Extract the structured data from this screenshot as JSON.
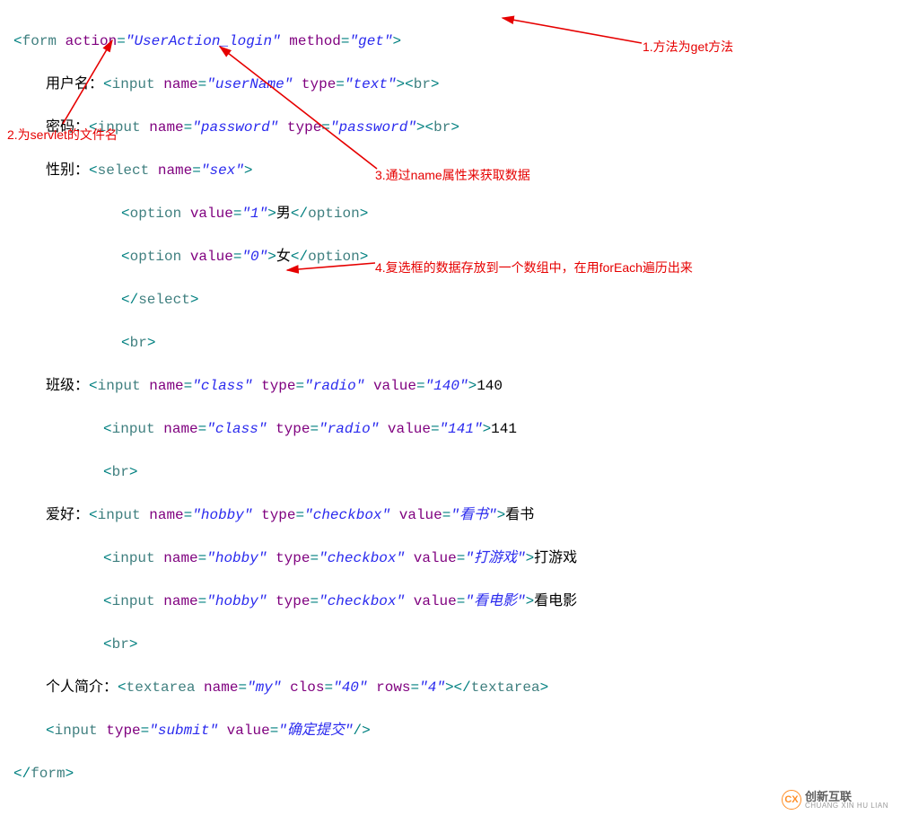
{
  "code": {
    "l1": {
      "b1": "<",
      "tag": "form",
      "a1": "action",
      "v1": "\"UserAction_login\"",
      "a2": "method",
      "v2": "\"get\"",
      "b2": ">"
    },
    "l2": {
      "label": "用户名：",
      "b1": "<",
      "tag": "input",
      "a1": "name",
      "v1": "\"userName\"",
      "a2": "type",
      "v2": "\"text\"",
      "b2": "><",
      "tag2": "br",
      "b3": ">"
    },
    "l3": {
      "label": "密码：",
      "b1": "<",
      "tag": "input",
      "a1": "name",
      "v1": "\"password\"",
      "a2": "type",
      "v2": "\"password\"",
      "b2": "><",
      "tag2": "br",
      "b3": ">"
    },
    "l4": {
      "label": "性别：",
      "b1": "<",
      "tag": "select",
      "a1": "name",
      "v1": "\"sex\"",
      "b2": ">"
    },
    "l5": {
      "b1": "<",
      "tag": "option",
      "a1": "value",
      "v1": "\"1\"",
      "b2": ">",
      "text": "男",
      "b3": "</",
      "tag2": "option",
      "b4": ">"
    },
    "l6": {
      "b1": "<",
      "tag": "option",
      "a1": "value",
      "v1": "\"0\"",
      "b2": ">",
      "text": "女",
      "b3": "</",
      "tag2": "option",
      "b4": ">"
    },
    "l7": {
      "b1": "</",
      "tag": "select",
      "b2": ">"
    },
    "l8": {
      "b1": "<",
      "tag": "br",
      "b2": ">"
    },
    "l9": {
      "label": "班级：",
      "b1": "<",
      "tag": "input",
      "a1": "name",
      "v1": "\"class\"",
      "a2": "type",
      "v2": "\"radio\"",
      "a3": "value",
      "v3": "\"140\"",
      "b2": ">",
      "text": "140"
    },
    "l10": {
      "b1": "<",
      "tag": "input",
      "a1": "name",
      "v1": "\"class\"",
      "a2": "type",
      "v2": "\"radio\"",
      "a3": "value",
      "v3": "\"141\"",
      "b2": ">",
      "text": "141"
    },
    "l11": {
      "b1": "<",
      "tag": "br",
      "b2": ">"
    },
    "l12": {
      "label": "爱好：",
      "b1": "<",
      "tag": "input",
      "a1": "name",
      "v1": "\"hobby\"",
      "a2": "type",
      "v2": "\"checkbox\"",
      "a3": "value",
      "v3": "\"看书\"",
      "b2": ">",
      "text": "看书"
    },
    "l13": {
      "b1": "<",
      "tag": "input",
      "a1": "name",
      "v1": "\"hobby\"",
      "a2": "type",
      "v2": "\"checkbox\"",
      "a3": "value",
      "v3": "\"打游戏\"",
      "b2": ">",
      "text": "打游戏"
    },
    "l14": {
      "b1": "<",
      "tag": "input",
      "a1": "name",
      "v1": "\"hobby\"",
      "a2": "type",
      "v2": "\"checkbox\"",
      "a3": "value",
      "v3": "\"看电影\"",
      "b2": ">",
      "text": "看电影"
    },
    "l15": {
      "b1": "<",
      "tag": "br",
      "b2": ">"
    },
    "l16": {
      "label": "个人简介：",
      "b1": "<",
      "tag": "textarea",
      "a1": "name",
      "v1": "\"my\"",
      "a2": "clos",
      "v2": "\"40\"",
      "a3": "rows",
      "v3": "\"4\"",
      "b2": "></",
      "tag2": "textarea",
      "b3": ">"
    },
    "l17": {
      "b1": "<",
      "tag": "input",
      "a1": "type",
      "v1": "\"submit\"",
      "a2": "value",
      "v2": "\"确定提交\"",
      "b2": "/>"
    },
    "l18": {
      "b1": "</",
      "tag": "form",
      "b2": ">"
    }
  },
  "annotations": {
    "n1": "1.方法为get方法",
    "n2": "2.为servlet的文件名",
    "n3": "3.通过name属性来获取数据",
    "n4": "4.复选框的数据存放到一个数组中，在用forEach遍历出来"
  },
  "logo": {
    "mark": "CX",
    "zh": "创新互联",
    "py": "CHUANG XIN HU LIAN"
  }
}
